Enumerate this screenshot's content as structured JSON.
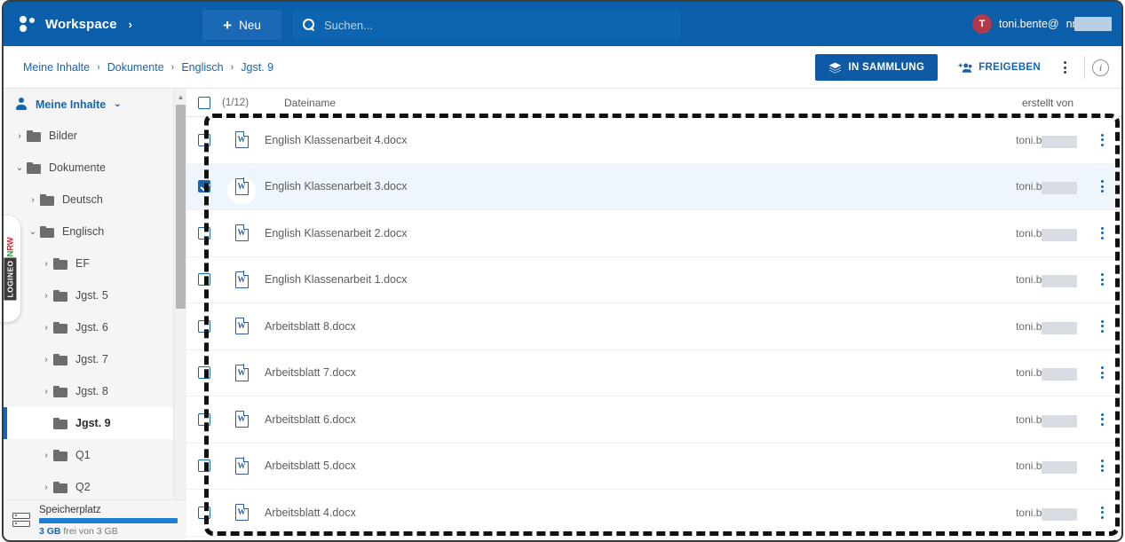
{
  "header": {
    "brand": "Workspace",
    "brand_chevron": "›",
    "new_button": "Neu",
    "new_plus": "+",
    "search_placeholder": "Suchen...",
    "search_value": "",
    "user_initial": "T",
    "user_email": "toni.bente@",
    "user_email_tail": "nrw.s",
    "user_caret": "⌄",
    "bg_color": "#0b5ea9",
    "new_button_color": "#1a69b5",
    "search_bg_color": "#0d64b1",
    "avatar_color": "#b03a4a"
  },
  "breadcrumb": {
    "items": [
      {
        "label": "Meine Inhalte"
      },
      {
        "label": "Dokumente"
      },
      {
        "label": "Englisch"
      },
      {
        "label": "Jgst. 9"
      }
    ],
    "separator": "›",
    "link_color": "#1565b4"
  },
  "actions": {
    "in_sammlung": "IN SAMMLUNG",
    "freigeben": "FREIGEBEN",
    "more_menu": "⋮",
    "info": "i"
  },
  "sidebar": {
    "root_label": "Meine Inhalte",
    "root_chevron": "⌄",
    "items": [
      {
        "label": "Bilder",
        "indent": 1,
        "arrow": "›",
        "selected": false
      },
      {
        "label": "Dokumente",
        "indent": 1,
        "arrow": "⌄",
        "selected": false
      },
      {
        "label": "Deutsch",
        "indent": 2,
        "arrow": "›",
        "selected": false
      },
      {
        "label": "Englisch",
        "indent": 2,
        "arrow": "⌄",
        "selected": false
      },
      {
        "label": "EF",
        "indent": 3,
        "arrow": "›",
        "selected": false
      },
      {
        "label": "Jgst. 5",
        "indent": 3,
        "arrow": "›",
        "selected": false
      },
      {
        "label": "Jgst. 6",
        "indent": 3,
        "arrow": "›",
        "selected": false
      },
      {
        "label": "Jgst. 7",
        "indent": 3,
        "arrow": "›",
        "selected": false
      },
      {
        "label": "Jgst. 8",
        "indent": 3,
        "arrow": "›",
        "selected": false
      },
      {
        "label": "Jgst. 9",
        "indent": 3,
        "arrow": "",
        "selected": true
      },
      {
        "label": "Q1",
        "indent": 3,
        "arrow": "›",
        "selected": false
      },
      {
        "label": "Q2",
        "indent": 3,
        "arrow": "›",
        "selected": false
      }
    ],
    "scroll_up": "▲",
    "scroll_down": "▼"
  },
  "storage": {
    "title": "Speicherplatz",
    "free_value": "3 GB",
    "free_rest": " frei von 3 GB",
    "percent": 100,
    "bar_color": "#1e7fd4"
  },
  "logineo": {
    "word": "LOGINEO",
    "n": "N",
    "r": "R",
    "w": "W"
  },
  "filelist": {
    "select_all_checked": false,
    "count_label": "(1/12)",
    "col_name": "Dateiname",
    "col_owner": "erstellt von",
    "rows": [
      {
        "name": "English Klassenarbeit 4.docx",
        "owner": "toni.bente@",
        "checked": false,
        "icon": "word-file-icon"
      },
      {
        "name": "English Klassenarbeit 3.docx",
        "owner": "toni.bente@",
        "checked": true,
        "icon": "word-file-icon"
      },
      {
        "name": "English Klassenarbeit 2.docx",
        "owner": "toni.bente@",
        "checked": false,
        "icon": "word-file-icon"
      },
      {
        "name": "English Klassenarbeit 1.docx",
        "owner": "toni.bente@",
        "checked": false,
        "icon": "word-file-icon"
      },
      {
        "name": "Arbeitsblatt 8.docx",
        "owner": "toni.bente@",
        "checked": false,
        "icon": "word-file-icon"
      },
      {
        "name": "Arbeitsblatt 7.docx",
        "owner": "toni.bente@",
        "checked": false,
        "icon": "word-file-icon"
      },
      {
        "name": "Arbeitsblatt 6.docx",
        "owner": "toni.bente@",
        "checked": false,
        "icon": "word-file-icon"
      },
      {
        "name": "Arbeitsblatt 5.docx",
        "owner": "toni.bente@",
        "checked": false,
        "icon": "word-file-icon"
      },
      {
        "name": "Arbeitsblatt 4.docx",
        "owner": "toni.bente@",
        "checked": false,
        "icon": "word-file-icon"
      }
    ],
    "word_icon_letter": "W"
  }
}
